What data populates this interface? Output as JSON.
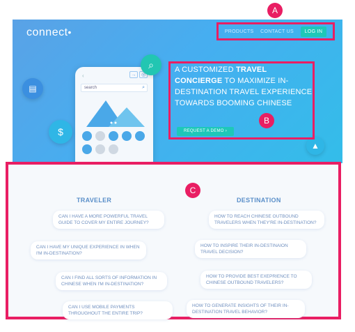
{
  "header": {
    "logo": "connect",
    "logo_dot": "•",
    "nav": {
      "products": "PRODUCTS",
      "contact": "CONTACT US",
      "login": "LOG IN"
    }
  },
  "badges": {
    "a": "A",
    "b": "B",
    "c": "C"
  },
  "phone": {
    "back": "‹",
    "ctrl1": "→",
    "ctrl2": "◎",
    "search_placeholder": "search",
    "search_icon": "⌕"
  },
  "hero": {
    "line_prefix": "A CUSTOMIZED ",
    "line_bold1": "TRAVEL CONCIERGE",
    "line_mid": " TO MAXIMIZE IN-DESTINATION TRAVEL EXPERIENCE TOWARDS BOOMING CHINESE",
    "cta": "REQUEST A DEMO  ›"
  },
  "traveler": {
    "title": "TRAVELER",
    "questions": [
      "CAN I HAVE A MORE POWERFUL TRAVEL GUIDE TO COVER MY ENTIRE JOURNEY?",
      "CAN I HAVE MY UNIQUE EXPERIENCE IN WHEN I'M IN-DESTINATION?",
      "CAN I FIND ALL SORTS OF INFORMATION IN CHINESE WHEN I'M IN-DESTINATION?",
      "CAN I USE MOBILE PAYMENTS THROUGHOUT THE ENTIRE TRIP?"
    ]
  },
  "destination": {
    "title": "DESTINATION",
    "questions": [
      "HOW TO REACH CHINESE OUTBOUND TRAVELERS WHEN THEY'RE IN-DESTINATION?",
      "HOW TO INSPIRE THEIR IN-DESTINAION TRAVEL DECISION?",
      "HOW TO PROVIDE BEST EXEPRIENCE TO CHINESE OUTBOUND TRAVELERS?",
      "HOW TO GENERATE INSIGHTS OF THEIR IN-DESTINATION TRAVEL BEHAVIOR?"
    ]
  },
  "colors": {
    "accent": "#e91e63",
    "teal": "#1ec8b8",
    "hero_blue": "#46aef0",
    "question_text": "#6f8fbf"
  }
}
